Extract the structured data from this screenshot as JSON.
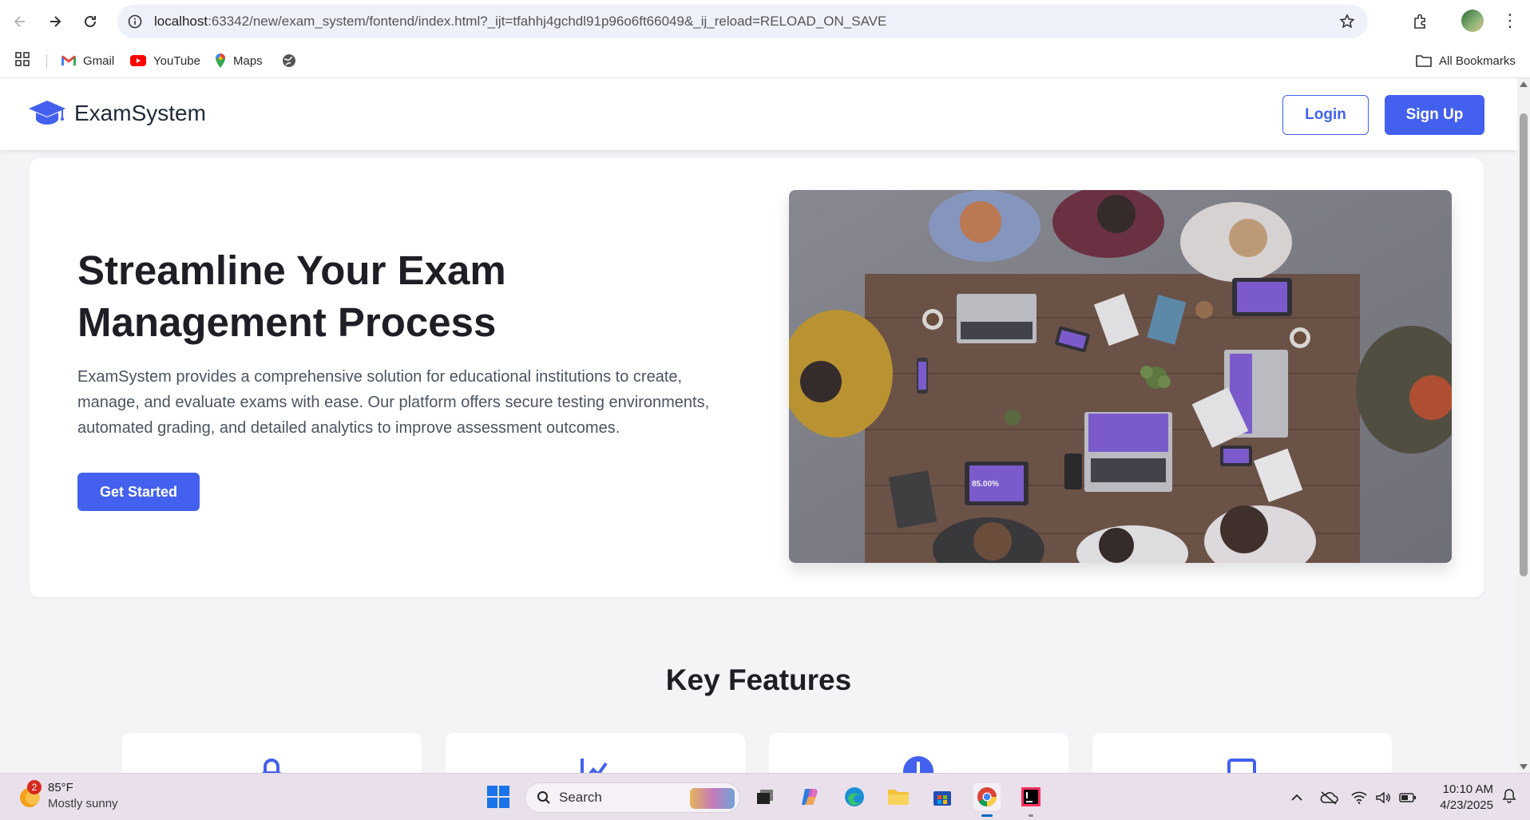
{
  "browser": {
    "url_host": "localhost",
    "url_rest": ":63342/new/exam_system/fontend/index.html?_ijt=tfahhj4gchdl91p96o6ft66049&_ij_reload=RELOAD_ON_SAVE",
    "bookmarks": [
      {
        "label": "Gmail",
        "icon": "gmail-icon"
      },
      {
        "label": "YouTube",
        "icon": "youtube-icon"
      },
      {
        "label": "Maps",
        "icon": "maps-icon"
      }
    ],
    "all_bookmarks_label": "All Bookmarks"
  },
  "site": {
    "brand": "ExamSystem",
    "login_label": "Login",
    "signup_label": "Sign Up",
    "accent_color": "#4361ee"
  },
  "hero": {
    "title_line1": "Streamline Your Exam",
    "title_line2": "Management Process",
    "description": "ExamSystem provides a comprehensive solution for educational institutions to create, manage, and evaluate exams with ease. Our platform offers secure testing environments, automated grading, and detailed analytics to improve assessment outcomes.",
    "cta_label": "Get Started",
    "image_tablet_text": "85.00%"
  },
  "features": {
    "title": "Key Features",
    "icons": [
      "lock-icon",
      "chart-line-icon",
      "info-circle-icon",
      "laptop-icon"
    ]
  },
  "taskbar": {
    "weather_badge": "2",
    "temperature": "85°F",
    "condition": "Mostly sunny",
    "search_label": "Search",
    "time": "10:10 AM",
    "date": "4/23/2025"
  }
}
